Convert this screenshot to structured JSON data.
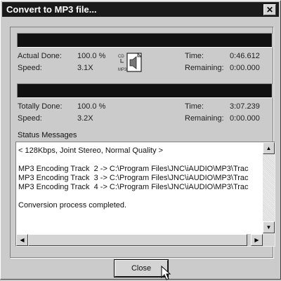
{
  "window": {
    "title": "Convert to MP3 file...",
    "close_glyph": "✕"
  },
  "track": {
    "progress_fraction": 1.0,
    "actual_done_label": "Actual Done:",
    "actual_done_value": "100.0 %",
    "speed_label": "Speed:",
    "speed_value": "3.1X",
    "time_label": "Time:",
    "time_value": "0:46.612",
    "remaining_label": "Remaining:",
    "remaining_value": "0:00.000"
  },
  "total": {
    "progress_fraction": 1.0,
    "totally_done_label": "Totally Done:",
    "totally_done_value": "100.0 %",
    "speed_label": "Speed:",
    "speed_value": "3.2X",
    "time_label": "Time:",
    "time_value": "3:07.239",
    "remaining_label": "Remaining:",
    "remaining_value": "0:00.000"
  },
  "icon": {
    "name": "cd-to-mp3-icon",
    "cd_text": "CD",
    "mp3_text": "MP3"
  },
  "status": {
    "label": "Status Messages",
    "lines": [
      "< 128Kbps, Joint Stereo, Normal Quality >",
      "",
      "MP3 Encoding Track  2 -> C:\\Program Files\\JNC\\iAUDIO\\MP3\\Trac",
      "MP3 Encoding Track  3 -> C:\\Program Files\\JNC\\iAUDIO\\MP3\\Trac",
      "MP3 Encoding Track  4 -> C:\\Program Files\\JNC\\iAUDIO\\MP3\\Trac",
      "",
      "Conversion process completed."
    ]
  },
  "buttons": {
    "close_label": "Close"
  }
}
